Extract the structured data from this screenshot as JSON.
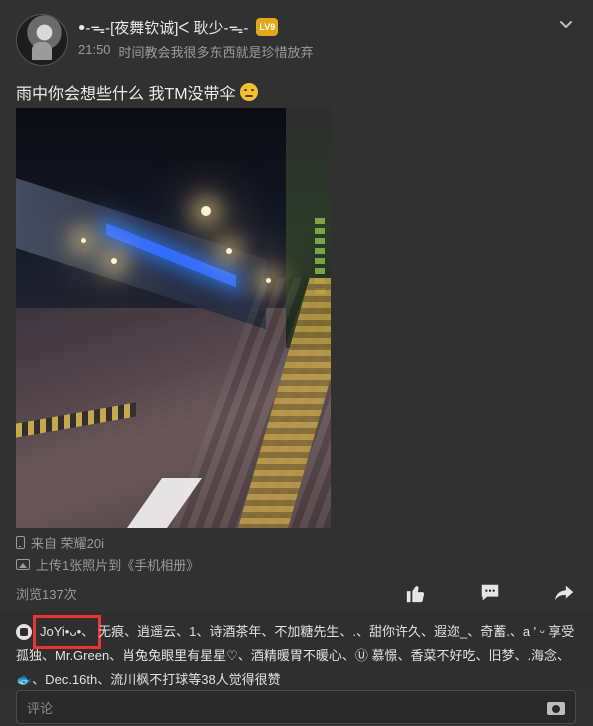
{
  "post": {
    "author": {
      "name": "ꔷ-ᯓ-[夜舞钦诚]ᐸ 耿少-ᯓ-",
      "badge": "LV9",
      "avatar": "avatar"
    },
    "meta": {
      "time": "21:50",
      "signature": "时间教会我很多东西就是珍惜放弃"
    },
    "text": "雨中你会想些什么 我TM没带伞",
    "emoji": "confused-face-emoji",
    "device": "来自 荣耀20i",
    "upload": "上传1张照片到《手机相册》",
    "views": "浏览137次",
    "actions": {
      "like_icon": "thumb-up-icon",
      "comment_icon": "comment-icon",
      "share_icon": "share-icon"
    }
  },
  "likes": {
    "first": "JoYi•ᴗ•、",
    "rest": "无痕、逍遥云、1、诗酒茶年、不加糖先生、.、甜你许久、遐迩_、奇蓄.、a ' ᵕ 享受孤独、Mr.Green、肖兔兔眼里有星星♡、酒精暖胃不暖心、Ⓤ 慕憬、香菜不好吃、旧梦、.海念、🐟、Dec.16th、流川枫不打球等38人觉得很赞"
  },
  "comment": {
    "placeholder": "评论",
    "camera_icon": "camera-icon"
  },
  "colors": {
    "background": "#313131",
    "text": "#e6e6e6",
    "muted": "#9a9a9a",
    "highlight": "#e53535",
    "badge": "#e5a61a"
  }
}
